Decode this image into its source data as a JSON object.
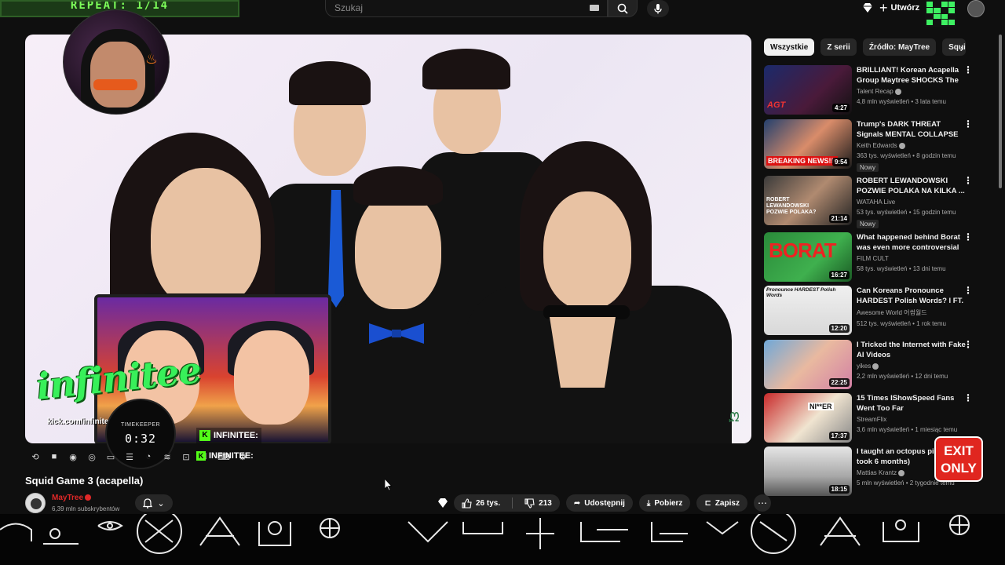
{
  "header": {
    "overlay_banner_text": "REPEAT: 1/14",
    "search_placeholder": "Szukaj",
    "create_label": "Utwórz",
    "icons": [
      "search-icon",
      "mic-icon",
      "bell-icon",
      "plus-icon"
    ]
  },
  "player": {
    "overlay": {
      "streamer_logo": "infinitee",
      "kick_url": "kick.com/infinitee",
      "timekeeper_label": "TIMEKEEPER",
      "timekeeper_time": "0:32",
      "kick_badge_top": "INFINITEE:",
      "kick_badge_bottom": "INFINITEE:"
    },
    "colors": {
      "accent_blue": "#1a5ad6",
      "kick_green": "#53fc18"
    }
  },
  "video": {
    "title": "Squid Game 3 (acapella)",
    "channel": "MayTree",
    "subscribers": "6,39 mln subskrybentów",
    "likes": "26 tys.",
    "dislikes": "213",
    "share_label": "Udostępnij",
    "download_label": "Pobierz",
    "save_label": "Zapisz"
  },
  "sidebar": {
    "chips": [
      "Wszystkie",
      "Z serii",
      "Źródło: MayTree",
      "Squid"
    ],
    "recommendations": [
      {
        "title": "BRILLIANT! Korean Acapella Group Maytree SHOCKS The ...",
        "channel": "Talent Recap",
        "verified": true,
        "meta": "4,8 mln wyświetleń • 3 lata temu",
        "duration": "4:27",
        "badge": ""
      },
      {
        "title": "Trump's DARK THREAT Signals MENTAL COLLAPSE",
        "channel": "Keith Edwards",
        "verified": true,
        "meta": "363 tys. wyświetleń • 8 godzin temu",
        "duration": "9:54",
        "badge": "Nowy"
      },
      {
        "title": "ROBERT LEWANDOWSKI POZWIE POLAKA NA KILKA ...",
        "channel": "WATAHA Live",
        "verified": false,
        "meta": "53 tys. wyświetleń • 15 godzin temu",
        "duration": "21:14",
        "badge": "Nowy"
      },
      {
        "title": "What happened behind Borat was even more controversial ...",
        "channel": "FILM CULT",
        "verified": false,
        "meta": "58 tys. wyświetleń • 13 dni temu",
        "duration": "16:27",
        "badge": ""
      },
      {
        "title": "Can Koreans Pronounce HARDEST Polish Words? l FT. ...",
        "channel": "Awesome World 어썸월드",
        "verified": false,
        "meta": "512 tys. wyświetleń • 1 rok temu",
        "duration": "12:20",
        "badge": ""
      },
      {
        "title": "I Tricked the Internet with Fake AI Videos",
        "channel": "yikes",
        "verified": true,
        "meta": "2,2 mln wyświetleń • 12 dni temu",
        "duration": "22:25",
        "badge": ""
      },
      {
        "title": "15 Times IShowSpeed Fans Went Too Far",
        "channel": "StreamFlix",
        "verified": false,
        "meta": "3,6 mln wyświetleń • 1 miesiąc temu",
        "duration": "17:37",
        "badge": ""
      },
      {
        "title": "I taught an octopus piano (it took 6 months)",
        "channel": "Mattias Krantz",
        "verified": true,
        "meta": "5 mln wyświetleń • 2 tygodnie temu",
        "duration": "18:15",
        "badge": ""
      }
    ],
    "thumb_captions": [
      "AGT",
      "BREAKING NEWS!!!",
      "ROBERT LEWANDOWSKI POZWIE POLAKA?",
      "BORAT",
      "Pronounce HARDEST Polish Words",
      "",
      "NI**ER",
      ""
    ]
  },
  "overlays": {
    "exit_sign_line1": "EXIT",
    "exit_sign_line2": "ONLY"
  }
}
